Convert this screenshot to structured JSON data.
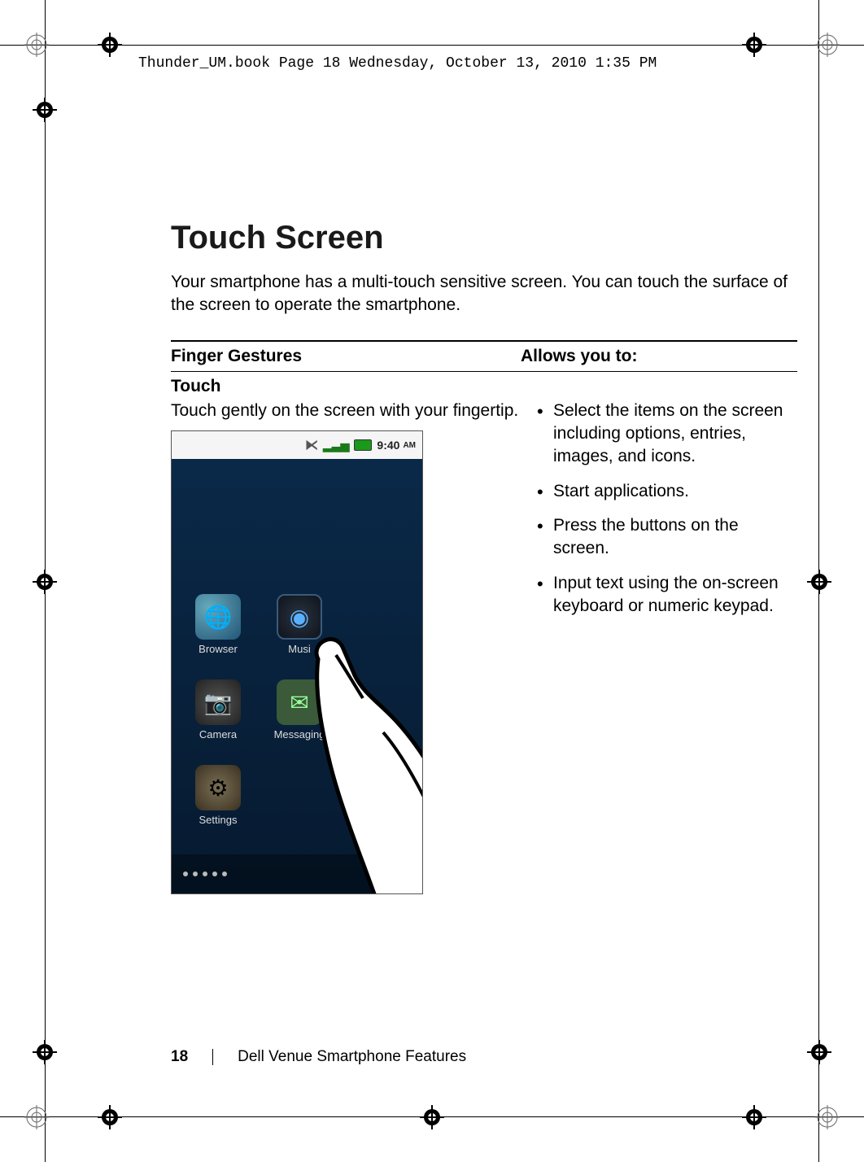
{
  "header_stamp": "Thunder_UM.book  Page 18  Wednesday, October 13, 2010  1:35 PM",
  "section_title": "Touch Screen",
  "intro": "Your smartphone has a multi-touch sensitive screen. You can touch the surface of the screen to operate the smartphone.",
  "table": {
    "col1_header": "Finger Gestures",
    "col2_header": "Allows you to:"
  },
  "gesture": {
    "name": "Touch",
    "description": "Touch gently on the screen with your fingertip."
  },
  "phone": {
    "time": "9:40",
    "time_suffix": "AM",
    "apps": {
      "browser": "Browser",
      "music": "Musi",
      "camera": "Camera",
      "messaging": "Messaging",
      "settings": "Settings"
    }
  },
  "allows": [
    "Select the items on the screen including options, entries, images, and icons.",
    "Start applications.",
    "Press the buttons on the screen.",
    "Input text using the on-screen keyboard or numeric keypad."
  ],
  "footer": {
    "page_number": "18",
    "book_section": "Dell Venue Smartphone Features"
  }
}
